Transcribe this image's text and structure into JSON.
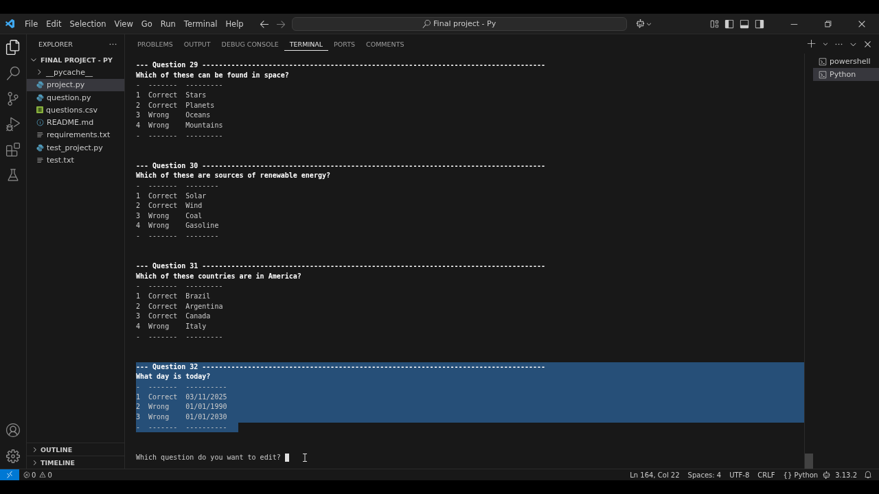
{
  "menu": [
    "File",
    "Edit",
    "Selection",
    "View",
    "Go",
    "Run",
    "Terminal",
    "Help"
  ],
  "command_center": {
    "value": "Final project - Py"
  },
  "explorer": {
    "title": "EXPLORER",
    "project": {
      "label": "FINAL PROJECT - PY",
      "expanded": true
    },
    "items": [
      {
        "label": "__pycache__",
        "kind": "folder",
        "expanded": false,
        "selected": false
      },
      {
        "label": "project.py",
        "kind": "python",
        "selected": true
      },
      {
        "label": "question.py",
        "kind": "python",
        "selected": false
      },
      {
        "label": "questions.csv",
        "kind": "csv",
        "selected": false
      },
      {
        "label": "README.md",
        "kind": "info",
        "selected": false
      },
      {
        "label": "requirements.txt",
        "kind": "text",
        "selected": false
      },
      {
        "label": "test_project.py",
        "kind": "python",
        "selected": false
      },
      {
        "label": "test.txt",
        "kind": "text",
        "selected": false
      }
    ],
    "sections": [
      {
        "label": "OUTLINE",
        "expanded": false
      },
      {
        "label": "TIMELINE",
        "expanded": false
      }
    ]
  },
  "panel_tabs": [
    {
      "label": "PROBLEMS",
      "selected": false
    },
    {
      "label": "OUTPUT",
      "selected": false
    },
    {
      "label": "DEBUG CONSOLE",
      "selected": false
    },
    {
      "label": "TERMINAL",
      "selected": true
    },
    {
      "label": "PORTS",
      "selected": false
    },
    {
      "label": "COMMENTS",
      "selected": false
    }
  ],
  "terminal": {
    "blocks": [
      {
        "header": "--- **Question 29** -----------------------------------------------------------------------------------",
        "question": "Which of these can be found in space?",
        "rule": "-  -------  ---------",
        "rows": [
          "1  Correct  Stars",
          "2  Correct  Planets",
          "3  Wrong    Oceans",
          "4  Wrong    Mountains"
        ],
        "selected": false
      },
      {
        "header": "--- **Question 30** -----------------------------------------------------------------------------------",
        "question": "Which of these are sources of renewable energy?",
        "rule": "-  -------  --------",
        "rows": [
          "1  Correct  Solar",
          "2  Correct  Wind",
          "3  Wrong    Coal",
          "4  Wrong    Gasoline"
        ],
        "selected": false
      },
      {
        "header": "--- **Question 31** -----------------------------------------------------------------------------------",
        "question": "Which of these countries are in America?",
        "rule": "-  -------  ---------",
        "rows": [
          "1  Correct  Brazil",
          "2  Correct  Argentina",
          "3  Correct  Canada",
          "4  Wrong    Italy"
        ],
        "selected": false
      },
      {
        "header": "--- **Question 32** -----------------------------------------------------------------------------------",
        "question": "What day is today?",
        "rule": "-  -------  ----------",
        "rows": [
          "1  Correct  03/11/2025",
          "2  Wrong    01/01/1990",
          "3  Wrong    01/01/2030"
        ],
        "selected": true
      }
    ],
    "prompt": "Which question do you want to edit?"
  },
  "terminal_list": [
    {
      "label": "powershell",
      "selected": false
    },
    {
      "label": "Python",
      "selected": true
    }
  ],
  "status_bar": {
    "errors": "0",
    "warnings": "0",
    "position": "Ln 164, Col 22",
    "spaces": "Spaces: 4",
    "encoding": "UTF-8",
    "eol": "CRLF",
    "language": "{} Python",
    "version": "3.13.2"
  }
}
